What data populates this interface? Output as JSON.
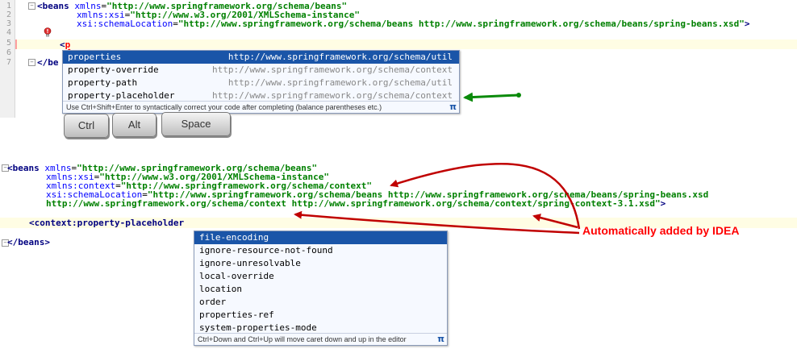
{
  "top_editor": {
    "line_numbers": [
      "1",
      "2",
      "3",
      "4",
      "5",
      "6",
      "7"
    ],
    "line1": {
      "open": "<beans",
      "attr": "xmlns",
      "eq": "=",
      "value": "\"http://www.springframework.org/schema/beans\""
    },
    "line2": {
      "attr": "xmlns:xsi",
      "eq": "=",
      "value": "\"http://www.w3.org/2001/XMLSchema-instance\""
    },
    "line3": {
      "attr": "xsi:schemaLocation",
      "eq": "=",
      "value": "\"http://www.springframework.org/schema/beans http://www.springframework.org/schema/beans/spring-beans.xsd\"",
      "close": ">"
    },
    "line5": {
      "lt": "<",
      "typed": "p"
    },
    "line7": {
      "text": "</be"
    }
  },
  "top_popup": {
    "items": [
      {
        "name": "properties",
        "uri": "http://www.springframework.org/schema/util"
      },
      {
        "name": "property-override",
        "uri": "http://www.springframework.org/schema/context"
      },
      {
        "name": "property-path",
        "uri": "http://www.springframework.org/schema/util"
      },
      {
        "name": "property-placeholder",
        "uri": "http://www.springframework.org/schema/context"
      }
    ],
    "footer": "Use Ctrl+Shift+Enter to syntactically correct your code after completing (balance parentheses etc.)",
    "pi": "π"
  },
  "keys": {
    "ctrl": "Ctrl",
    "alt": "Alt",
    "space": "Space"
  },
  "bottom_editor": {
    "line1": {
      "open": "<beans",
      "attr": "xmlns",
      "eq": "=",
      "value": "\"http://www.springframework.org/schema/beans\""
    },
    "line2": {
      "attr": "xmlns:xsi",
      "eq": "=",
      "value": "\"http://www.w3.org/2001/XMLSchema-instance\""
    },
    "line3": {
      "attr": "xmlns:context",
      "eq": "=",
      "value": "\"http://www.springframework.org/schema/context\""
    },
    "line4": {
      "attr": "xsi:schemaLocation",
      "eq": "=",
      "value": "\"http://www.springframework.org/schema/beans http://www.springframework.org/schema/beans/spring-beans.xsd"
    },
    "line5": {
      "value": "http://www.springframework.org/schema/context http://www.springframework.org/schema/context/spring-context-3.1.xsd\"",
      "close": ">"
    },
    "line7": {
      "indent_lt": "<",
      "ns": "context",
      "colon": ":",
      "tagname": "property-placeholder"
    },
    "line9": {
      "text": "</beans>"
    }
  },
  "bottom_popup": {
    "items": [
      "file-encoding",
      "ignore-resource-not-found",
      "ignore-unresolvable",
      "local-override",
      "location",
      "order",
      "properties-ref",
      "system-properties-mode"
    ],
    "footer": "Ctrl+Down and Ctrl+Up will move caret down and up in the editor",
    "pi": "π"
  },
  "annotation": {
    "text": "Automatically added by IDEA",
    "color": "#ff0000"
  },
  "colors": {
    "selection": "#1a55a8",
    "green_arrow": "#0a8a0a",
    "red_arrow": "#c00000",
    "tag": "#000080",
    "attr": "#0000ff",
    "value": "#008000"
  },
  "icons": {
    "bulb": "error-bulb-icon",
    "fold": "fold-marker-icon",
    "pi": "pi-icon"
  }
}
